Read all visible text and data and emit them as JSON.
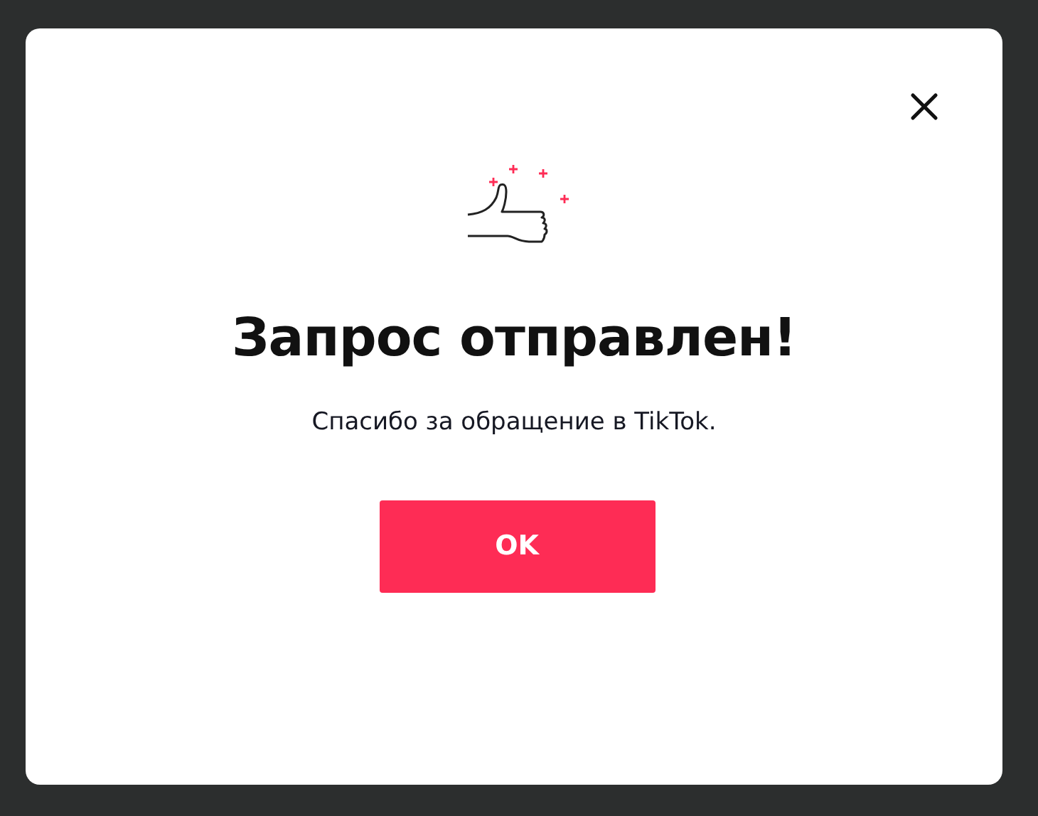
{
  "dialog": {
    "title": "Запрос отправлен!",
    "message": "Спасибо за обращение в TikTok.",
    "button": "OK"
  }
}
